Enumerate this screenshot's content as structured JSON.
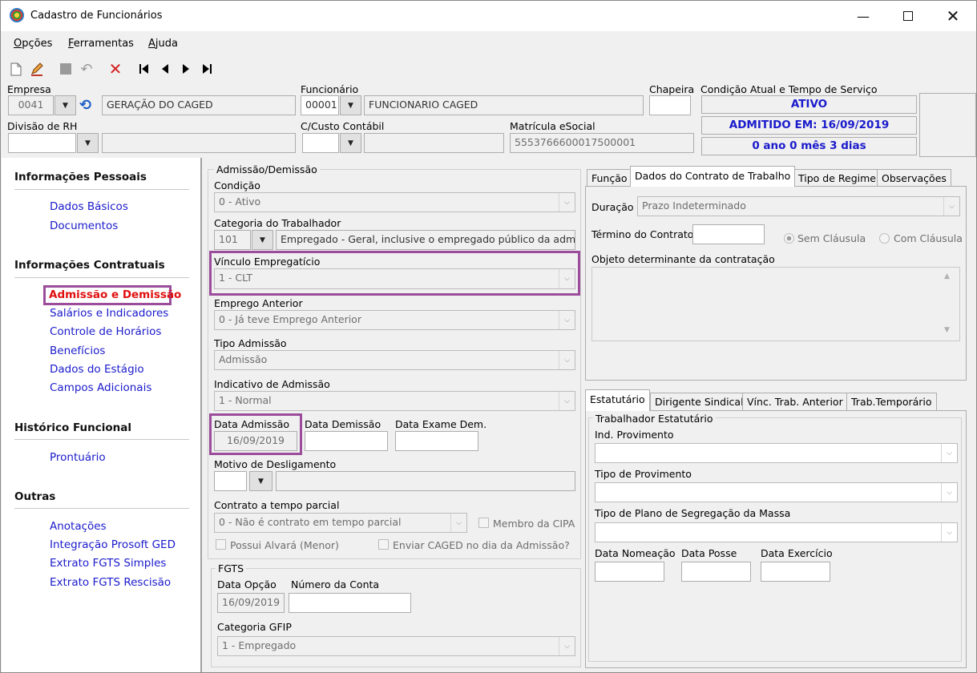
{
  "window": {
    "title": "Cadastro de Funcionários"
  },
  "menu": {
    "opcoes": "Opções",
    "ferramentas": "Ferramentas",
    "ajuda": "Ajuda"
  },
  "header": {
    "empresa_label": "Empresa",
    "empresa_code": "0041",
    "empresa_name": "GERAÇÃO DO CAGED",
    "funcionario_label": "Funcionário",
    "funcionario_code": "00001",
    "funcionario_name": "FUNCIONARIO CAGED",
    "chapeira_label": "Chapeira",
    "chapeira_value": "",
    "condicao_label": "Condição Atual e Tempo de Serviço",
    "status_ativo": "ATIVO",
    "status_admitido": "ADMITIDO EM: 16/09/2019",
    "status_tempo": "0 ano 0 mês 3 dias",
    "divisao_label": "Divisão de RH",
    "ccusto_label": "C/Custo Contábil",
    "matricula_label": "Matrícula eSocial",
    "matricula_value": "5553766600017500001"
  },
  "sidebar": {
    "sections": [
      {
        "title": "Informações Pessoais",
        "items": [
          "Dados Básicos",
          "Documentos"
        ]
      },
      {
        "title": "Informações Contratuais",
        "items": [
          "Admissão e Demissão",
          "Salários e Indicadores",
          "Controle de Horários",
          "Benefícios",
          "Dados do Estágio",
          "Campos Adicionais"
        ]
      },
      {
        "title": "Histórico Funcional",
        "items": [
          "Prontuário"
        ]
      },
      {
        "title": "Outras",
        "items": [
          "Anotações",
          "Integração Prosoft GED",
          "Extrato FGTS Simples",
          "Extrato FGTS Rescisão"
        ]
      }
    ],
    "active_item": "Admissão e Demissão"
  },
  "admissao": {
    "group_label": "Admissão/Demissão",
    "condicao_label": "Condição",
    "condicao_value": "0 - Ativo",
    "categoria_label": "Categoria do Trabalhador",
    "categoria_code": "101",
    "categoria_desc": "Empregado - Geral, inclusive o empregado público da administ",
    "vinculo_label": "Vínculo Empregatício",
    "vinculo_value": "1 - CLT",
    "emprego_anterior_label": "Emprego Anterior",
    "emprego_anterior_value": "0 - Já teve Emprego Anterior",
    "tipo_admissao_label": "Tipo Admissão",
    "tipo_admissao_value": "Admissão",
    "indicativo_label": "Indicativo de Admissão",
    "indicativo_value": "1 - Normal",
    "data_admissao_label": "Data Admissão",
    "data_admissao_value": "16/09/2019",
    "data_demissao_label": "Data Demissão",
    "data_exame_label": "Data Exame Dem.",
    "motivo_label": "Motivo de Desligamento",
    "contrato_parcial_label": "Contrato a tempo parcial",
    "contrato_parcial_value": "0 - Não é contrato em tempo parcial",
    "membro_cipa": "Membro da CIPA",
    "possui_alvara": "Possui Alvará (Menor)",
    "enviar_caged": "Enviar CAGED no dia da Admissão?"
  },
  "fgts": {
    "group_label": "FGTS",
    "data_opcao_label": "Data Opção",
    "data_opcao_value": "16/09/2019",
    "numero_conta_label": "Número da Conta",
    "categoria_gfip_label": "Categoria GFIP",
    "categoria_gfip_value": "1 - Empregado"
  },
  "contrato_tabs": {
    "tabs": [
      "Função",
      "Dados do Contrato de Trabalho",
      "Tipo de Regime",
      "Observações"
    ],
    "duracao_label": "Duração",
    "duracao_value": "Prazo Indeterminado",
    "termino_label": "Término do Contrato",
    "sem_clausula": "Sem Cláusula",
    "com_clausula": "Com Cláusula",
    "objeto_label": "Objeto determinante da contratação"
  },
  "estatutario_tabs": {
    "tabs": [
      "Estatutário",
      "Dirigente Sindical",
      "Vínc. Trab. Anterior",
      "Trab.Temporário"
    ],
    "group_label": "Trabalhador Estatutário",
    "ind_provimento": "Ind. Provimento",
    "tipo_provimento": "Tipo de Provimento",
    "tipo_plano": "Tipo de Plano de Segregação da Massa",
    "data_nomeacao": "Data Nomeação",
    "data_posse": "Data Posse",
    "data_exercicio": "Data Exercício"
  }
}
